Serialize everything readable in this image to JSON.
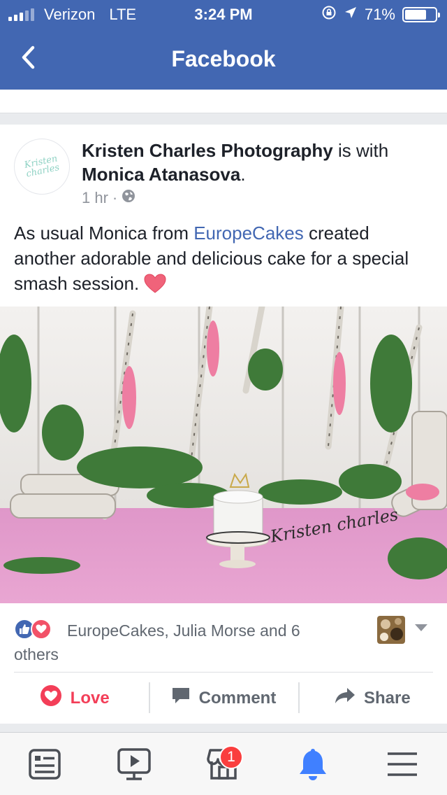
{
  "status_bar": {
    "carrier": "Verizon",
    "network": "LTE",
    "time": "3:24 PM",
    "battery_percent": "71%",
    "battery_level": 0.71,
    "icons": [
      "signal-icon",
      "rotation-lock-icon",
      "location-arrow-icon",
      "battery-icon"
    ]
  },
  "nav": {
    "title": "Facebook",
    "back_icon": "chevron-left-icon"
  },
  "post": {
    "author": "Kristen Charles Photography",
    "with_text": " is with ",
    "tagged": "Monica Atanasova",
    "tagged_suffix": ".",
    "time": "1 hr",
    "separator": " · ",
    "privacy_icon": "globe-icon",
    "avatar_logo": "Kristen charles",
    "text_before": "As usual Monica from ",
    "text_link": "EuropeCakes",
    "text_after": " created another adorable and delicious cake for a special smash session. ",
    "emoji": "heart-emoji",
    "photo_watermark": "Kristen charles",
    "reactions_text": "EuropeCakes, Julia Morse and 6 others",
    "reaction_icons": [
      "like-icon",
      "love-icon"
    ]
  },
  "actions": {
    "love": "Love",
    "comment": "Comment",
    "share": "Share"
  },
  "tabbar": {
    "tabs": [
      "news-feed-icon",
      "watch-icon",
      "marketplace-icon",
      "notifications-icon",
      "menu-icon"
    ],
    "marketplace_badge": "1"
  },
  "colors": {
    "brand": "#4267b2",
    "love": "#f33e58",
    "badge": "#fa3e3e",
    "active_tab": "#4080ff"
  }
}
